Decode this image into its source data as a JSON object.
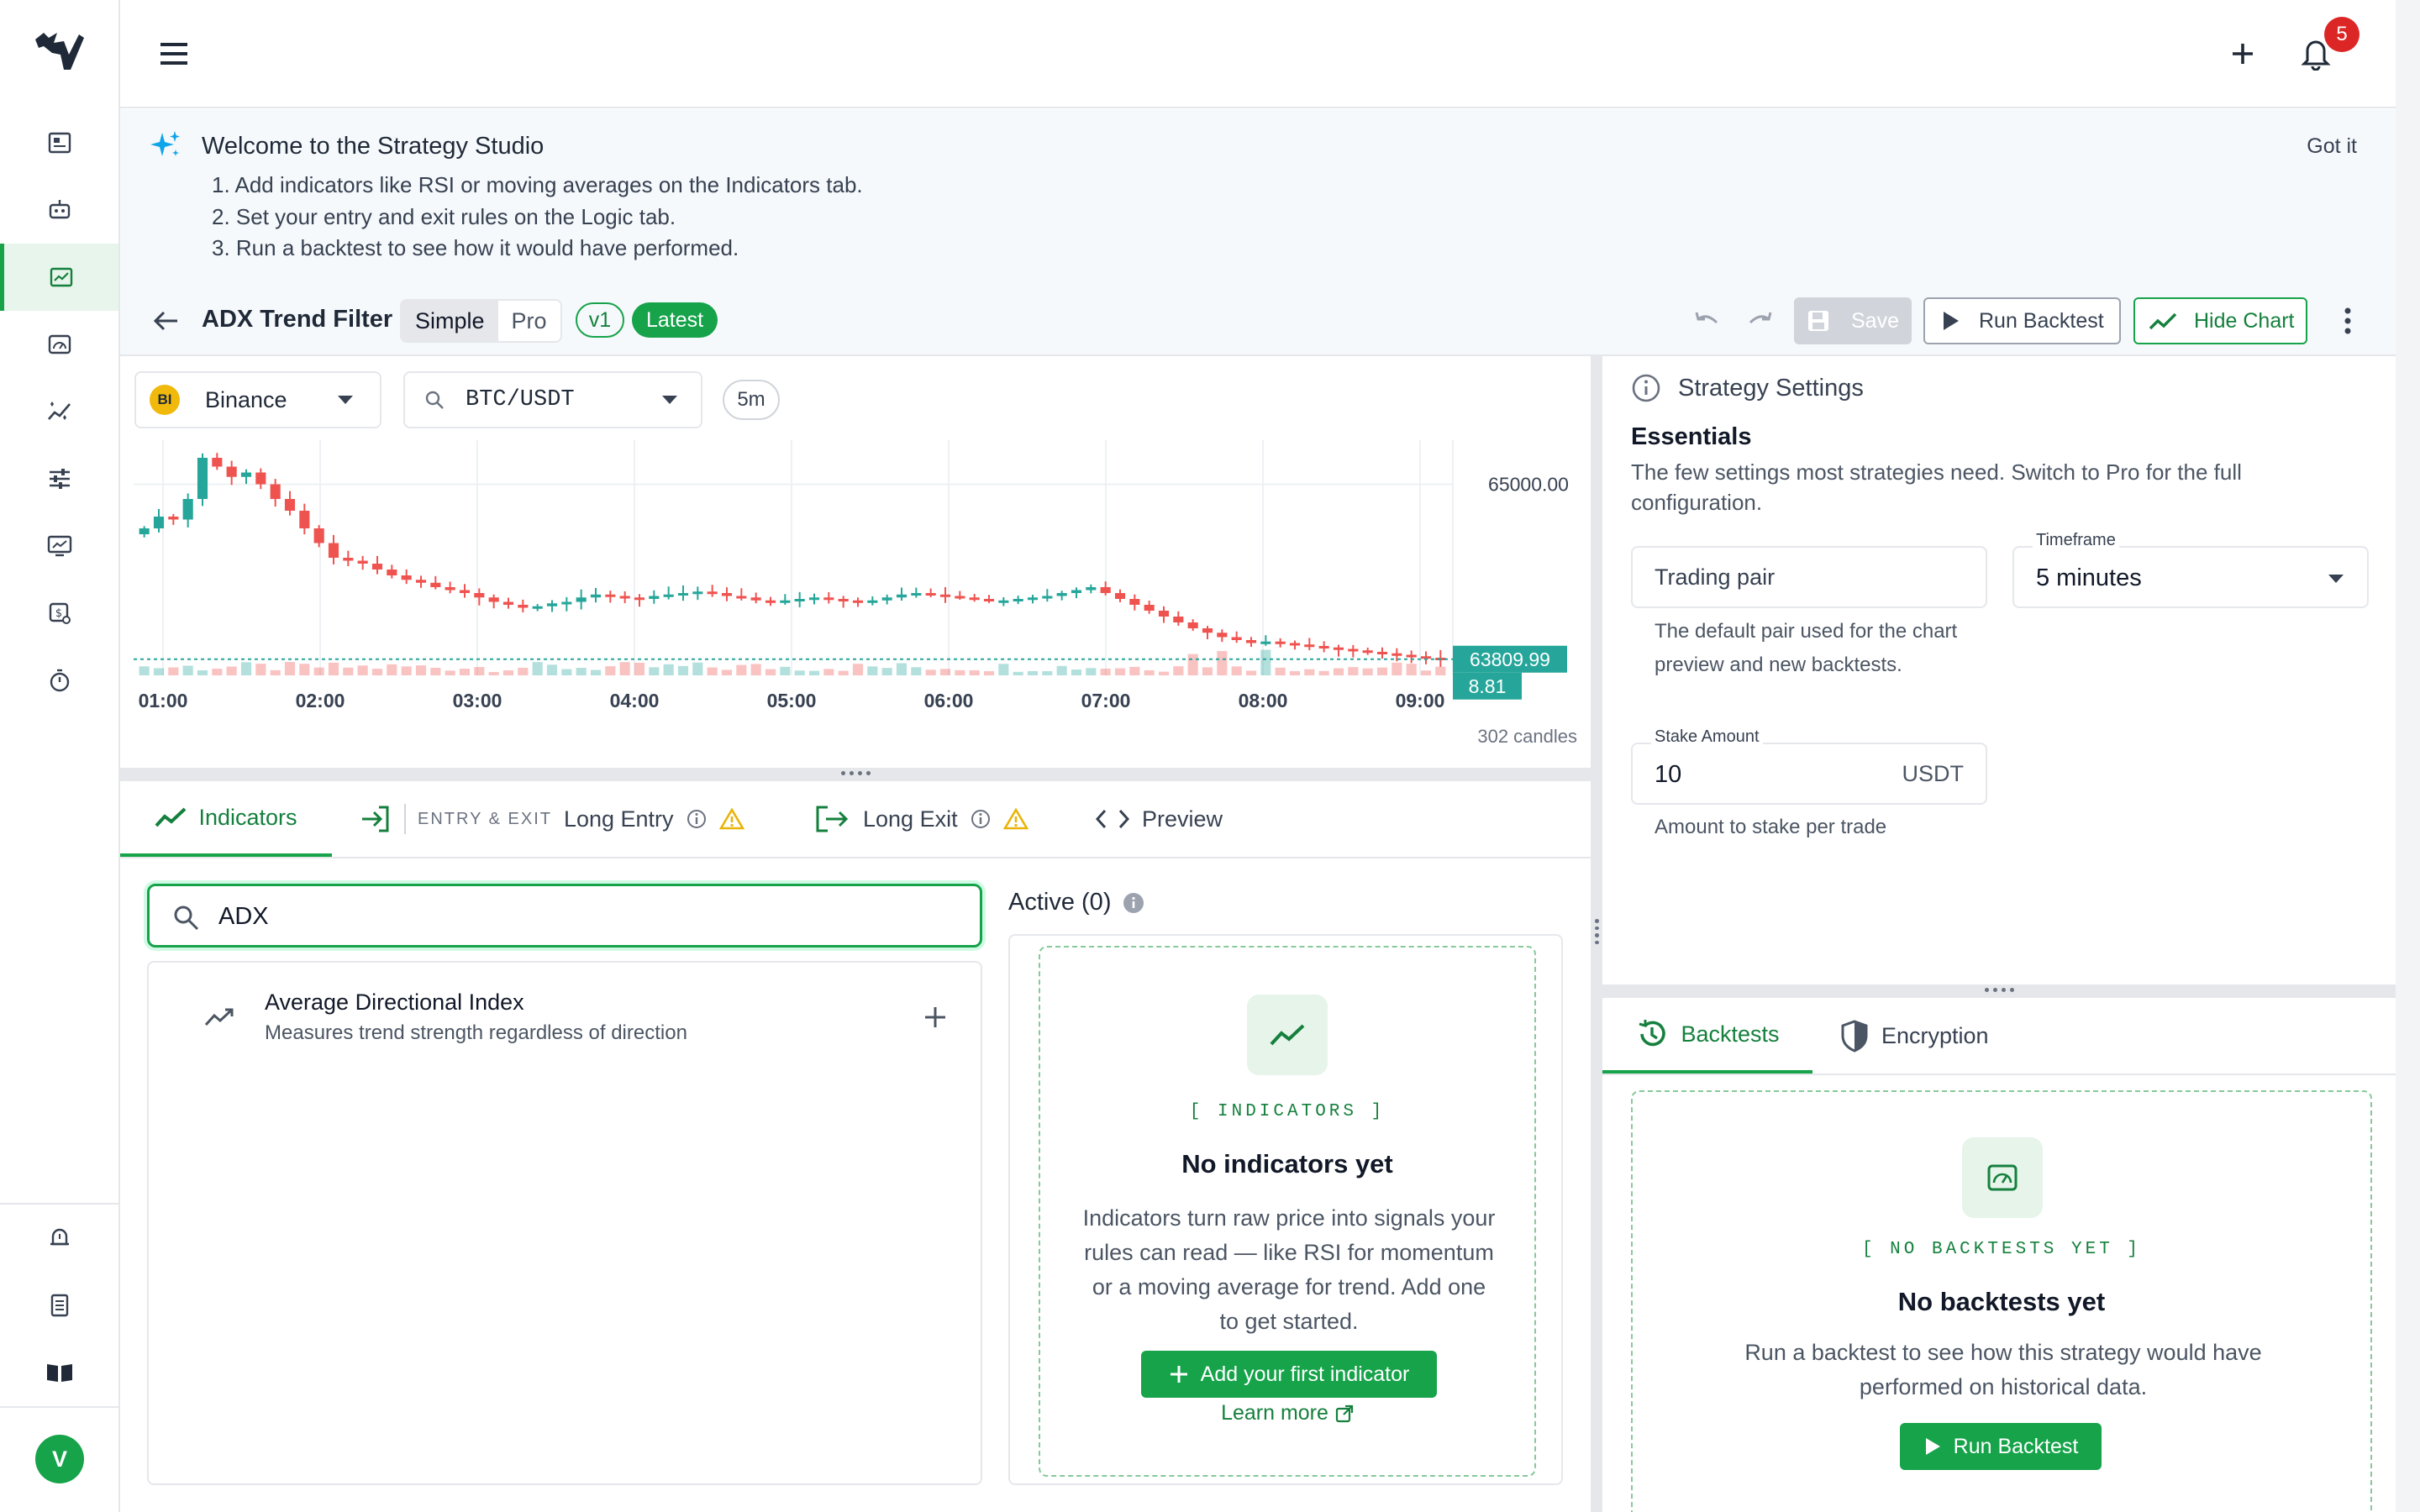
{
  "topbar": {
    "notification_count": "5"
  },
  "banner": {
    "title": "Welcome to the Strategy Studio",
    "steps": [
      "1. Add indicators like RSI or moving averages on the Indicators tab.",
      "2. Set your entry and exit rules on the Logic tab.",
      "3. Run a backtest to see how it would have performed."
    ],
    "dismiss": "Got it"
  },
  "toolbar": {
    "strategy_name": "ADX Trend Filter",
    "mode_simple": "Simple",
    "mode_pro": "Pro",
    "version": "v1",
    "version_tag": "Latest",
    "save": "Save",
    "run_backtest": "Run Backtest",
    "hide_chart": "Hide Chart"
  },
  "chart": {
    "exchange": "Binance",
    "exchange_badge": "BI",
    "pair": "BTC/USDT",
    "timeframe": "5m",
    "candle_count": "302 candles"
  },
  "chart_data": {
    "type": "candlestick",
    "x_ticks": [
      "01:00",
      "02:00",
      "03:00",
      "04:00",
      "05:00",
      "06:00",
      "07:00",
      "08:00",
      "09:00"
    ],
    "y_ticks": [
      "65000.00"
    ],
    "last_price": "63809.99",
    "last_volume": "8.81",
    "ylim": [
      63700,
      65300
    ],
    "close_series": [
      64700,
      64780,
      64760,
      64900,
      65180,
      65120,
      65050,
      65080,
      65000,
      64900,
      64820,
      64700,
      64600,
      64500,
      64480,
      64460,
      64420,
      64380,
      64350,
      64330,
      64300,
      64280,
      64260,
      64230,
      64200,
      64180,
      64160,
      64170,
      64190,
      64200,
      64230,
      64250,
      64240,
      64230,
      64220,
      64240,
      64250,
      64260,
      64270,
      64260,
      64240,
      64230,
      64210,
      64200,
      64210,
      64220,
      64230,
      64220,
      64210,
      64200,
      64210,
      64230,
      64250,
      64260,
      64250,
      64240,
      64230,
      64220,
      64210,
      64210,
      64220,
      64230,
      64240,
      64260,
      64280,
      64300,
      64260,
      64220,
      64180,
      64140,
      64100,
      64060,
      64020,
      63990,
      63960,
      63940,
      63920,
      63930,
      63920,
      63910,
      63900,
      63890,
      63880,
      63870,
      63860,
      63850,
      63840,
      63830,
      63820,
      63810
    ]
  },
  "tabs": {
    "indicators": "Indicators",
    "entry_exit_group": "ENTRY & EXIT",
    "long_entry": "Long Entry",
    "long_exit": "Long Exit",
    "preview": "Preview"
  },
  "search": {
    "value": "ADX"
  },
  "results": [
    {
      "title": "Average Directional Index",
      "desc": "Measures trend strength regardless of direction"
    }
  ],
  "active": {
    "header": "Active (0)",
    "tag": "[ INDICATORS ]",
    "heading": "No indicators yet",
    "body": "Indicators turn raw price into signals your rules can read — like RSI for momentum or a moving average for trend. Add one to get started.",
    "cta": "Add your first indicator",
    "learn_more": "Learn more"
  },
  "settings": {
    "title": "Strategy Settings",
    "section": "Essentials",
    "section_desc": "The few settings most strategies need. Switch to Pro for the full configuration.",
    "trading_pair_label": "Trading pair",
    "trading_pair_help": "The default pair used for the chart preview and new backtests.",
    "timeframe_label": "Timeframe",
    "timeframe_value": "5 minutes",
    "stake_label": "Stake Amount",
    "stake_value": "10",
    "stake_unit": "USDT",
    "stake_help": "Amount to stake per trade"
  },
  "right_tabs": {
    "backtests": "Backtests",
    "encryption": "Encryption"
  },
  "backtests": {
    "tag": "[ NO BACKTESTS YET ]",
    "heading": "No backtests yet",
    "body": "Run a backtest to see how this strategy would have performed on historical data.",
    "cta": "Run Backtest"
  },
  "user": {
    "avatar_initial": "V"
  },
  "colors": {
    "accent": "#16a34a",
    "up": "#26a69a",
    "down": "#ef5350"
  }
}
